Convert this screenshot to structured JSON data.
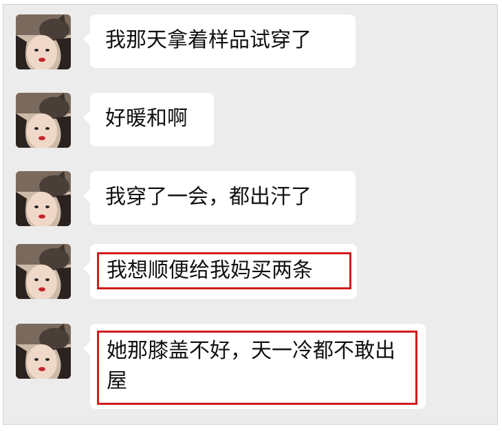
{
  "chat": {
    "messages": [
      {
        "text": "我那天拿着样品试穿了",
        "highlighted": false
      },
      {
        "text": "好暖和啊",
        "highlighted": false
      },
      {
        "text": "我穿了一会，都出汗了",
        "highlighted": false
      },
      {
        "text": "我想顺便给我妈买两条",
        "highlighted": true
      },
      {
        "text": "她那膝盖不好，天一冷都不敢出屋",
        "highlighted": true
      }
    ]
  },
  "colors": {
    "background": "#ececec",
    "bubble": "#ffffff",
    "highlight": "#d11a1a",
    "text": "#111111"
  },
  "icons": {
    "avatar": "user-avatar-with-cat"
  }
}
